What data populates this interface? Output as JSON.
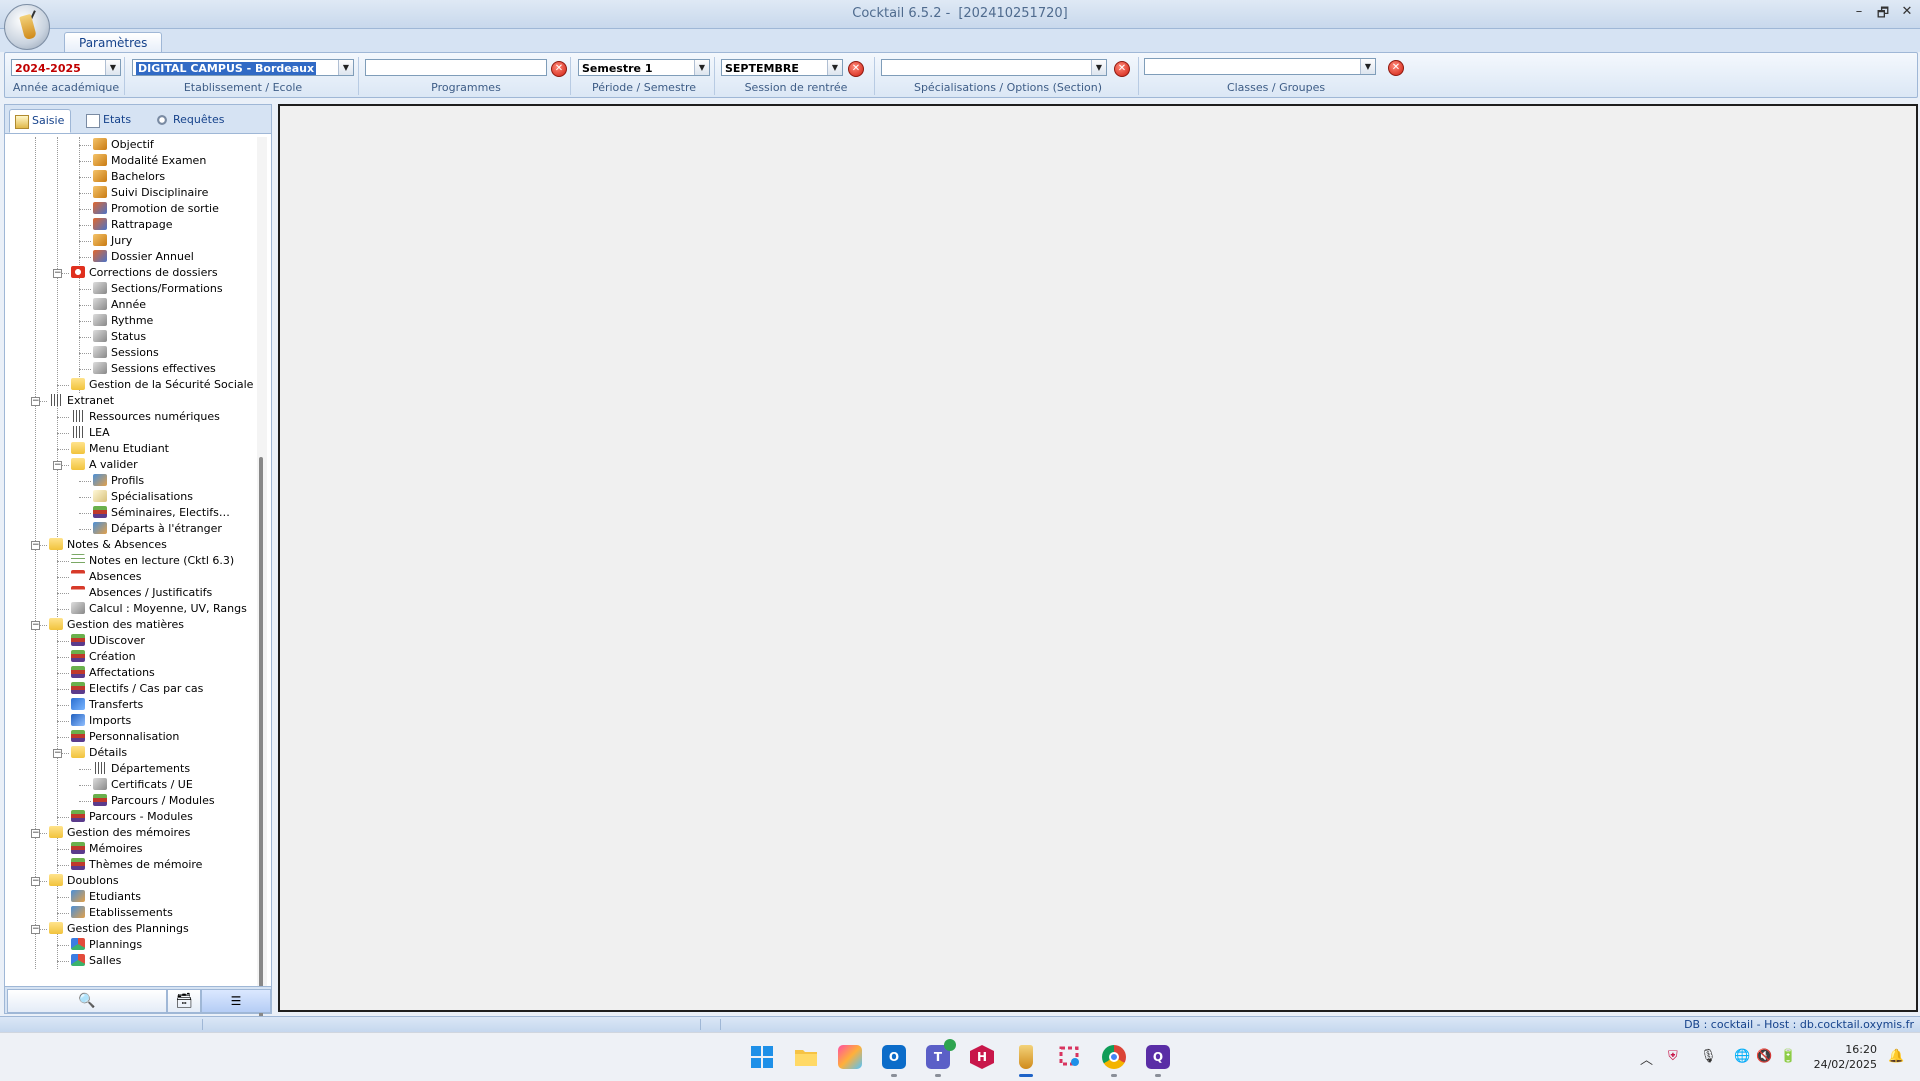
{
  "window": {
    "title": "Cocktail 6.5.2 -",
    "build": "[202410251720]",
    "controls": {
      "minimize": "–",
      "restore": "🗗",
      "close": "✕"
    }
  },
  "ribbon": {
    "tab": "Paramètres",
    "groups": [
      {
        "id": "annee",
        "label": "Année académique",
        "value": "2024-2025"
      },
      {
        "id": "etab",
        "label": "Etablissement / Ecole",
        "value": "DIGITAL CAMPUS - Bordeaux"
      },
      {
        "id": "prog",
        "label": "Programmes",
        "value": ""
      },
      {
        "id": "periode",
        "label": "Période / Semestre",
        "value": "Semestre 1"
      },
      {
        "id": "session",
        "label": "Session de rentrée",
        "value": "SEPTEMBRE"
      },
      {
        "id": "spec",
        "label": "Spécialisations / Options (Section)",
        "value": ""
      },
      {
        "id": "classes",
        "label": "Classes / Groupes",
        "value": ""
      }
    ]
  },
  "left_panel": {
    "tabs": [
      "Saisie",
      "Etats",
      "Requêtes"
    ],
    "tree": [
      {
        "label": "Objectif",
        "level": 2,
        "icon": "key-icon"
      },
      {
        "label": "Modalité Examen",
        "level": 2,
        "icon": "key-icon"
      },
      {
        "label": "Bachelors",
        "level": 2,
        "icon": "key-icon"
      },
      {
        "label": "Suivi Disciplinaire",
        "level": 2,
        "icon": "key-icon"
      },
      {
        "label": "Promotion de sortie",
        "level": 2,
        "icon": "people-icon"
      },
      {
        "label": "Rattrapage",
        "level": 2,
        "icon": "people-icon"
      },
      {
        "label": "Jury",
        "level": 2,
        "icon": "key-icon"
      },
      {
        "label": "Dossier Annuel",
        "level": 2,
        "icon": "people-icon"
      },
      {
        "label": "Corrections de dossiers",
        "level": 1,
        "icon": "lifebuoy-icon",
        "expander": "−"
      },
      {
        "label": "Sections/Formations",
        "level": 2,
        "icon": "pen-icon"
      },
      {
        "label": "Année",
        "level": 2,
        "icon": "pen-icon"
      },
      {
        "label": "Rythme",
        "level": 2,
        "icon": "pen-icon"
      },
      {
        "label": "Status",
        "level": 2,
        "icon": "pen-icon"
      },
      {
        "label": "Sessions",
        "level": 2,
        "icon": "pen-icon"
      },
      {
        "label": "Sessions effectives",
        "level": 2,
        "icon": "pen-icon"
      },
      {
        "label": "Gestion de la Sécurité Sociale",
        "level": 1,
        "icon": "folder-icon"
      },
      {
        "label": "Extranet",
        "level": 0,
        "icon": "globe-icon",
        "expander": "−"
      },
      {
        "label": "Ressources numériques",
        "level": 1,
        "icon": "globe-icon"
      },
      {
        "label": "LEA",
        "level": 1,
        "icon": "globe-icon"
      },
      {
        "label": "Menu Etudiant",
        "level": 1,
        "icon": "folder-icon"
      },
      {
        "label": "A valider",
        "level": 1,
        "icon": "folder-icon",
        "expander": "−"
      },
      {
        "label": "Profils",
        "level": 2,
        "icon": "user-icon"
      },
      {
        "label": "Spécialisations",
        "level": 2,
        "icon": "scroll-icon"
      },
      {
        "label": "Séminaires, Electifs…",
        "level": 2,
        "icon": "books-icon"
      },
      {
        "label": "Départs à l'étranger",
        "level": 2,
        "icon": "user-icon"
      },
      {
        "label": "Notes & Absences",
        "level": 0,
        "icon": "folder-icon",
        "expander": "−"
      },
      {
        "label": "Notes en lecture (Cktl 6.3)",
        "level": 1,
        "icon": "grid-icon"
      },
      {
        "label": "Absences",
        "level": 1,
        "icon": "calendar-icon"
      },
      {
        "label": "Absences / Justificatifs",
        "level": 1,
        "icon": "calendar-icon"
      },
      {
        "label": "Calcul : Moyenne, UV, Rangs",
        "level": 1,
        "icon": "pen-icon"
      },
      {
        "label": "Gestion des matières",
        "level": 0,
        "icon": "folder-icon",
        "expander": "−"
      },
      {
        "label": "UDiscover",
        "level": 1,
        "icon": "books-icon"
      },
      {
        "label": "Création",
        "level": 1,
        "icon": "books-icon"
      },
      {
        "label": "Affectations",
        "level": 1,
        "icon": "books-icon"
      },
      {
        "label": "Electifs / Cas par cas",
        "level": 1,
        "icon": "books-icon"
      },
      {
        "label": "Transferts",
        "level": 1,
        "icon": "transfer-icon"
      },
      {
        "label": "Imports",
        "level": 1,
        "icon": "import-icon"
      },
      {
        "label": "Personnalisation",
        "level": 1,
        "icon": "books-icon"
      },
      {
        "label": "Détails",
        "level": 1,
        "icon": "folder-icon",
        "expander": "−"
      },
      {
        "label": "Départements",
        "level": 2,
        "icon": "globe-icon"
      },
      {
        "label": "Certificats / UE",
        "level": 2,
        "icon": "pen-icon"
      },
      {
        "label": "Parcours / Modules",
        "level": 2,
        "icon": "books-icon"
      },
      {
        "label": "Parcours - Modules",
        "level": 1,
        "icon": "books-icon"
      },
      {
        "label": "Gestion des mémoires",
        "level": 0,
        "icon": "folder-icon",
        "expander": "−"
      },
      {
        "label": "Mémoires",
        "level": 1,
        "icon": "books-icon"
      },
      {
        "label": "Thèmes de mémoire",
        "level": 1,
        "icon": "books-icon"
      },
      {
        "label": "Doublons",
        "level": 0,
        "icon": "folder-icon",
        "expander": "−"
      },
      {
        "label": "Etudiants",
        "level": 1,
        "icon": "user-icon"
      },
      {
        "label": "Etablissements",
        "level": 1,
        "icon": "user-icon"
      },
      {
        "label": "Gestion des Plannings",
        "level": 0,
        "icon": "folder-icon",
        "expander": "−"
      },
      {
        "label": "Plannings",
        "level": 1,
        "icon": "shapes-icon"
      },
      {
        "label": "Salles",
        "level": 1,
        "icon": "shapes-icon"
      }
    ],
    "footer_buttons": [
      "search-icon",
      "archive-icon",
      "list-icon"
    ]
  },
  "status": {
    "db_info": "DB : cocktail - Host : db.cocktail.oxymis.fr"
  },
  "taskbar": {
    "apps": [
      "start-icon",
      "file-explorer-icon",
      "photos-icon",
      "outlook-icon",
      "teams-icon",
      "h-app-icon",
      "cocktail-icon",
      "snipping-tool-icon",
      "chrome-icon",
      "q-app-icon"
    ],
    "time": "16:20",
    "date": "24/02/2025"
  },
  "colors": {
    "accent": "#15428b",
    "label": "#3d5c86",
    "year_text": "#c00000",
    "selection": "#316ac5"
  }
}
